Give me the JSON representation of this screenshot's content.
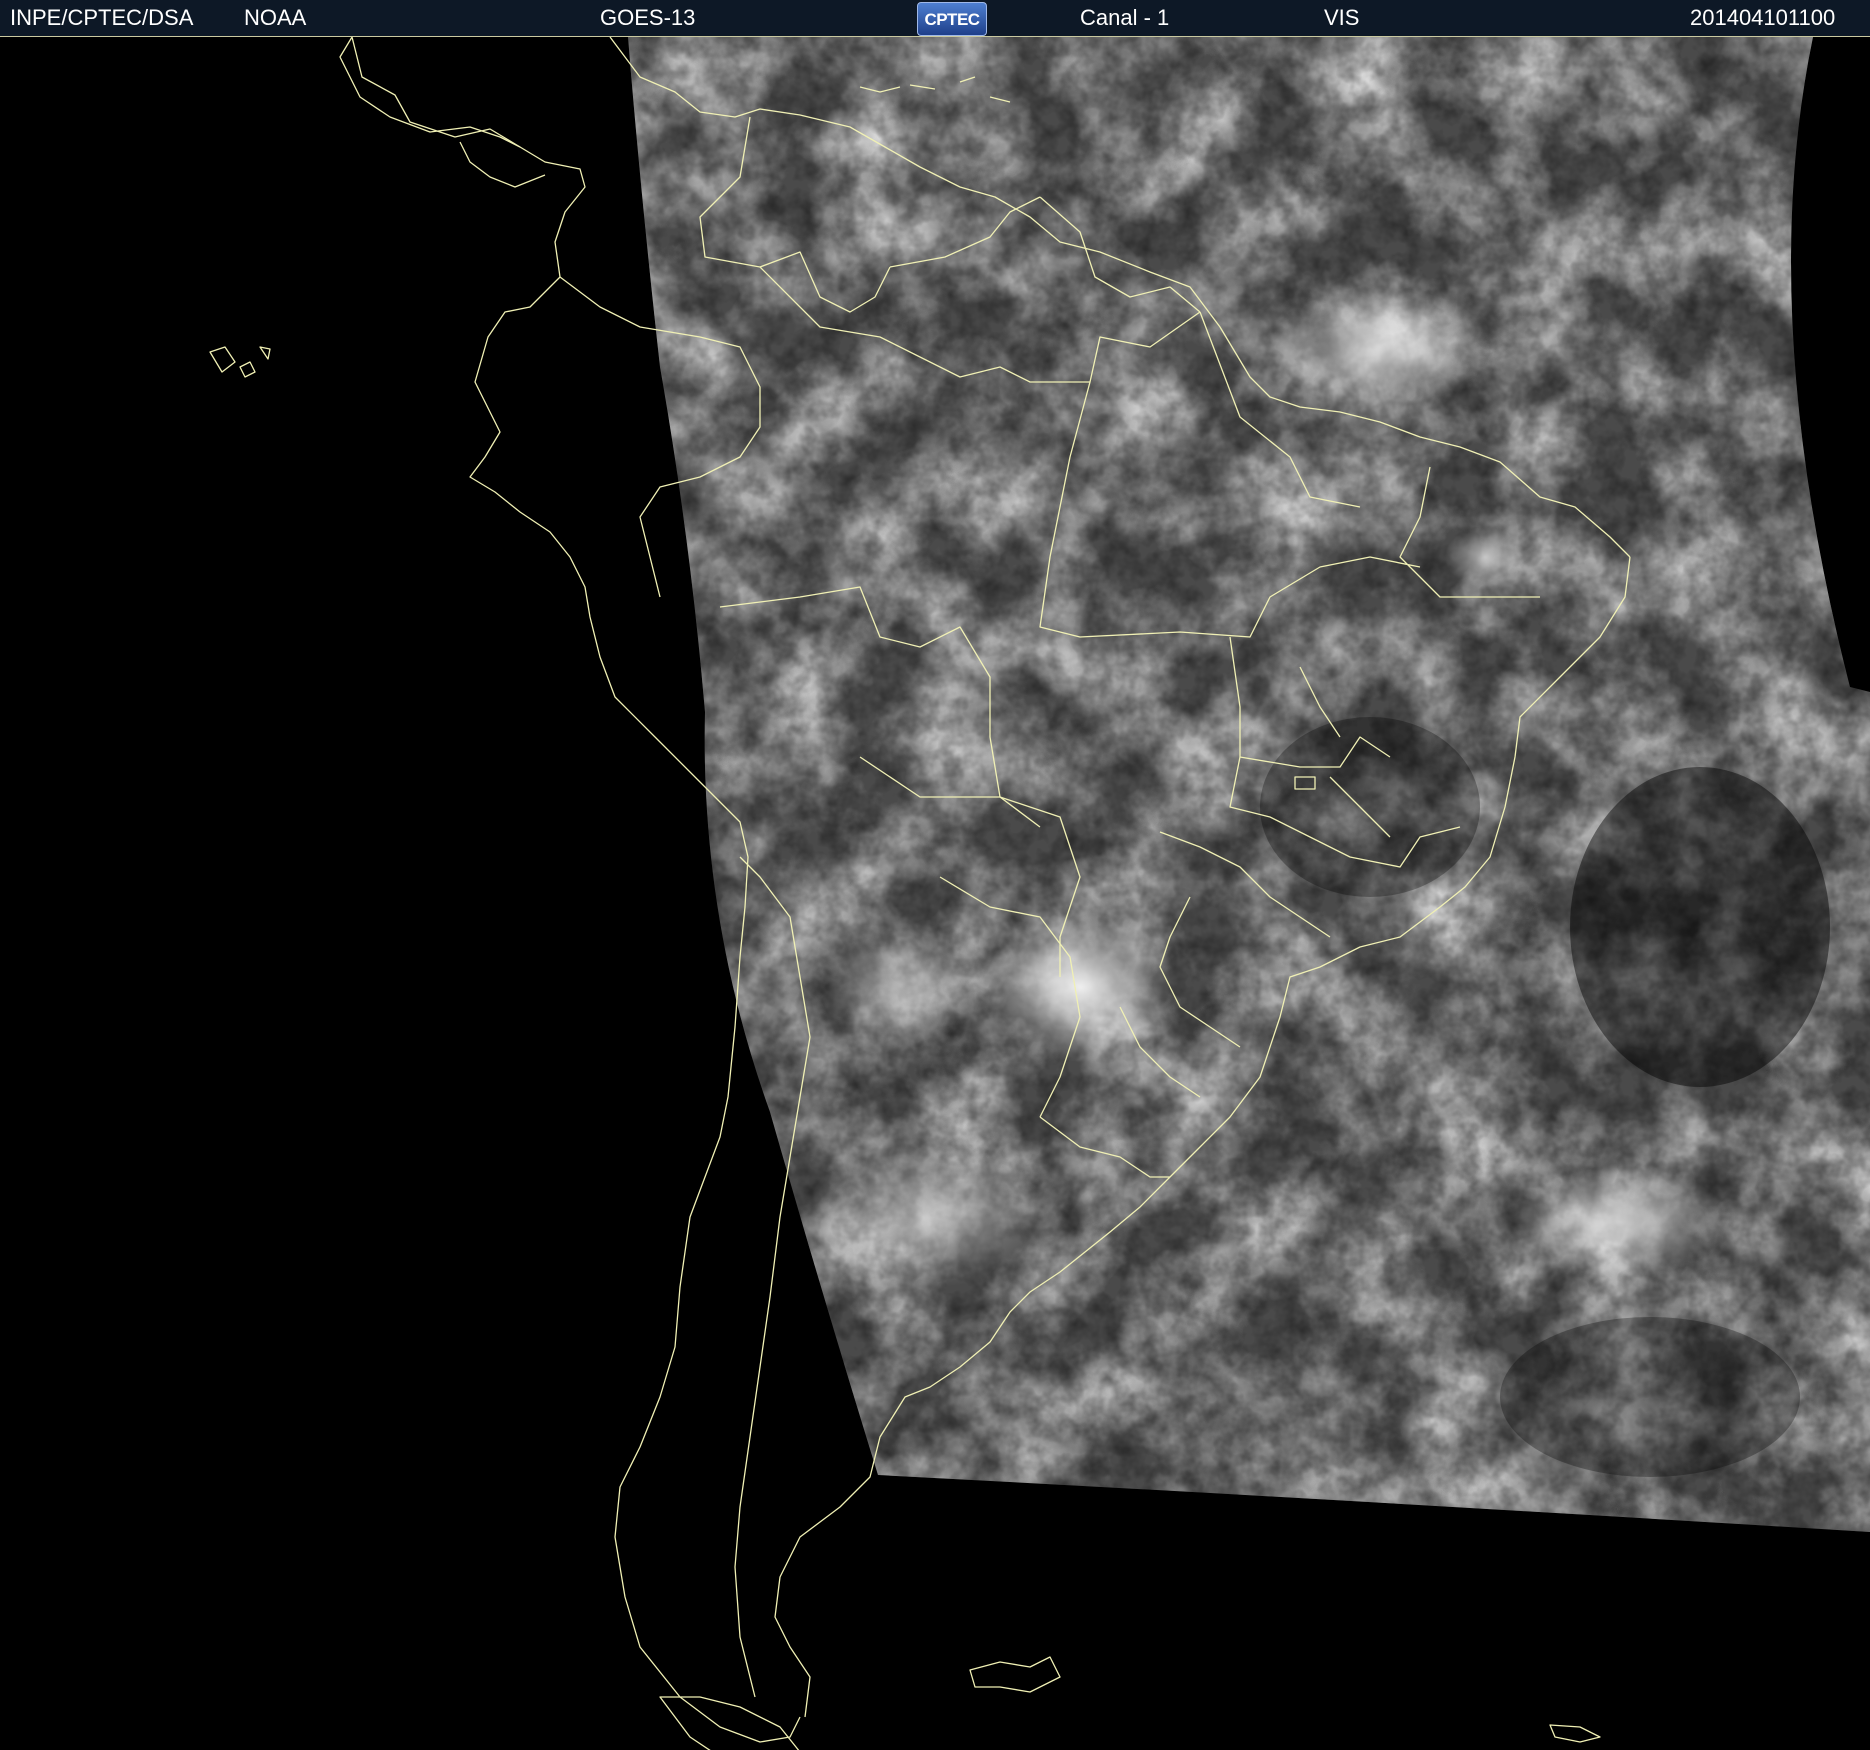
{
  "header": {
    "agency": "INPE/CPTEC/DSA",
    "partner": "NOAA",
    "satellite": "GOES-13",
    "logo_text": "CPTEC",
    "channel": "Canal - 1",
    "band": "VIS",
    "timestamp": "201404101100"
  },
  "colors": {
    "header_bg": "#0d1826",
    "border_lines": "#f0f0b4",
    "background": "#000000"
  }
}
